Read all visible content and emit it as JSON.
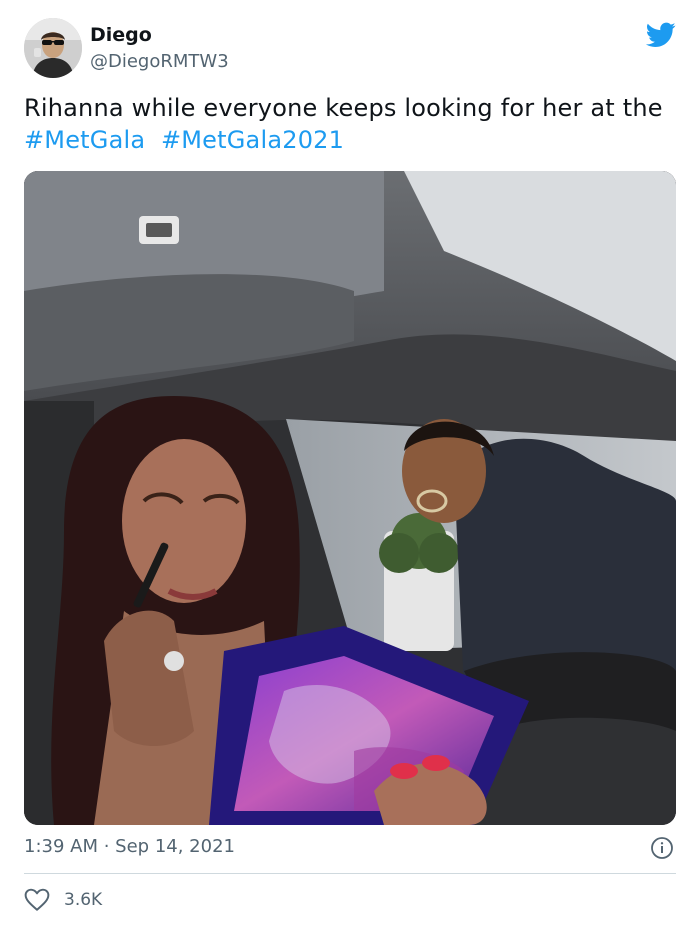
{
  "author": {
    "name": "Diego",
    "handle": "@DiegoRMTW3"
  },
  "tweet": {
    "text_plain": "Rihanna while everyone keeps looking for her at the",
    "hashtags": [
      "#MetGala",
      "#MetGala2021"
    ]
  },
  "meta": {
    "time": "1:39 AM",
    "separator": " · ",
    "date": "Sep 14, 2021"
  },
  "engagement": {
    "likes": "3.6K"
  },
  "icons": {
    "brand": "twitter-bird-icon",
    "info": "info-icon",
    "like": "heart-icon"
  },
  "colors": {
    "accent": "#1d9bf0",
    "text": "#0f1419",
    "secondary": "#536471",
    "divider": "#cfd9de"
  }
}
